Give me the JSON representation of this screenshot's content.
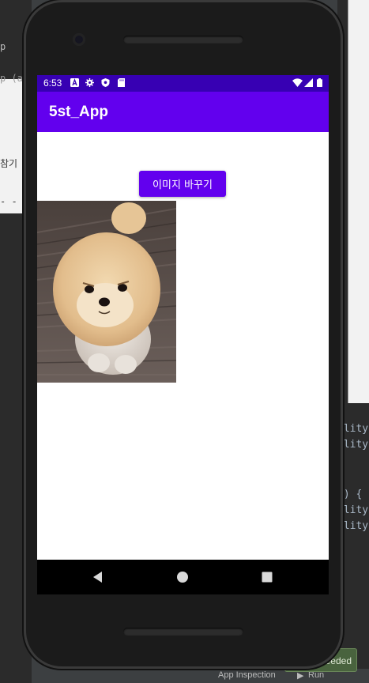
{
  "status_bar": {
    "time": "6:53",
    "icons": [
      "notification-a-icon",
      "settings-icon",
      "shield-icon",
      "sd-card-icon",
      "wifi-icon",
      "signal-icon",
      "battery-icon"
    ]
  },
  "app_bar": {
    "title": "5st_App"
  },
  "main": {
    "change_image_button": "이미지 바꾸기",
    "image_subject": "pomeranian-dog-photo"
  },
  "nav_bar": {
    "icons": [
      "back-icon",
      "home-icon",
      "recent-apps-icon"
    ]
  },
  "ide_background": {
    "left_snippets": [
      "p",
      "p (and",
      "참기",
      "- -"
    ],
    "right_code": [
      "ility(",
      "ility(",
      "1) {",
      "ility(",
      "ility"
    ],
    "bottom_tabs": [
      "App Inspection",
      "Run"
    ],
    "toast": "ceeded"
  },
  "colors": {
    "status_bar": "#3700b3",
    "app_bar": "#6200ee",
    "button": "#6200ee",
    "phone_body": "#1b1b1b"
  }
}
